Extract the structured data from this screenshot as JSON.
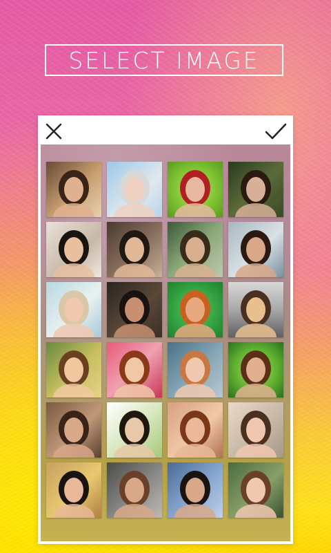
{
  "title": "SELECT IMAGE",
  "header": {
    "close_icon": "close-icon",
    "confirm_icon": "checkmark-icon"
  },
  "images": [
    {
      "bg": "linear-gradient(135deg,#6a4a3a,#c8a070 55%,#e8d0b0)",
      "face": "#e0b090",
      "hair": "#3a2418"
    },
    {
      "bg": "linear-gradient(135deg,#9ec8e8,#dfe8ee 60%,#b8d4ea)",
      "face": "#f0d0c0",
      "hair": "#d8d8d8"
    },
    {
      "bg": "radial-gradient(circle,#c0e060 0%,#7ac030 60%,#5a9a20)",
      "face": "#e8b8a0",
      "hair": "#b02020"
    },
    {
      "bg": "linear-gradient(135deg,#2a3a20,#5a6a38 50%,#3a4a28)",
      "face": "#d8b098",
      "hair": "#2a1a10"
    },
    {
      "bg": "linear-gradient(135deg,#e8e0d8,#c8b8a8 60%,#f0e8e0)",
      "face": "#e8c0a0",
      "hair": "#1a1410"
    },
    {
      "bg": "linear-gradient(135deg,#4a3a30,#8a7060 55%,#c8b098)",
      "face": "#e0b898",
      "hair": "#201812"
    },
    {
      "bg": "linear-gradient(135deg,#3a5a38,#8aa878 50%,#c0c8b0)",
      "face": "#d8b090",
      "hair": "#3a2a1a"
    },
    {
      "bg": "linear-gradient(135deg,#a8b8c0,#d8e0e4 55%,#7890a0)",
      "face": "#d8a888",
      "hair": "#2a1a12"
    },
    {
      "bg": "linear-gradient(135deg,#b8d8e0,#e8f0f0 55%,#a8c8d8)",
      "face": "#f0c8b0",
      "hair": "#d8c8a8"
    },
    {
      "bg": "linear-gradient(135deg,#2a2420,#5a4838 55%,#3a3028)",
      "face": "#c89070",
      "hair": "#181210"
    },
    {
      "bg": "radial-gradient(circle,#60c860 0%,#30a040 60%,#208030)",
      "face": "#e8a880",
      "hair": "#c86020"
    },
    {
      "bg": "linear-gradient(180deg,#d8d8d8,#a8a8a8 50%,#606060)",
      "face": "#e8c090",
      "hair": "#4a3020"
    },
    {
      "bg": "linear-gradient(135deg,#6a8a40,#c8c060 55%,#e8d088)",
      "face": "#f0c8a0",
      "hair": "#6a4020"
    },
    {
      "bg": "linear-gradient(135deg,#e85a7a,#f0a0b0 50%,#c83858)",
      "face": "#f0c8a8",
      "hair": "#8a3a18"
    },
    {
      "bg": "linear-gradient(135deg,#4a7088,#88a8b8 55%,#b8c8d0)",
      "face": "#f0c8b0",
      "hair": "#c87840"
    },
    {
      "bg": "radial-gradient(circle,#a8e060 0%,#60b030 55%,#2a7020)",
      "face": "#e0b090",
      "hair": "#5a3018"
    },
    {
      "bg": "linear-gradient(135deg,#7a5a40,#c09878 55%,#5a4030)",
      "face": "#d8a888",
      "hair": "#3a2418"
    },
    {
      "bg": "linear-gradient(135deg,#ffffff,#d8e8c0 50%,#a8c878)",
      "face": "#e8c8a8",
      "hair": "#201810"
    },
    {
      "bg": "linear-gradient(135deg,#d8a080,#f0c8a8 55%,#b07050)",
      "face": "#e8b898",
      "hair": "#7a3818"
    },
    {
      "bg": "linear-gradient(135deg,#e8d8c8,#c8b8a8 55%,#a8988a)",
      "face": "#f0c8b0",
      "hair": "#4a3020"
    },
    {
      "bg": "linear-gradient(135deg,#c8a060,#e8c870 55%,#b08040)",
      "face": "#e8b898",
      "hair": "#1a1410"
    },
    {
      "bg": "linear-gradient(135deg,#4a4a48,#8a8a88 55%,#c0b8b0)",
      "face": "#d8a888",
      "hair": "#6a4028"
    },
    {
      "bg": "linear-gradient(135deg,#4a6a98,#88a8d0 55%,#c0d0e8)",
      "face": "#d8a888",
      "hair": "#1a1410"
    },
    {
      "bg": "linear-gradient(135deg,#4a6a40,#88a068 55%,#3a5030)",
      "face": "#f0c8b0",
      "hair": "#6a4028"
    }
  ]
}
